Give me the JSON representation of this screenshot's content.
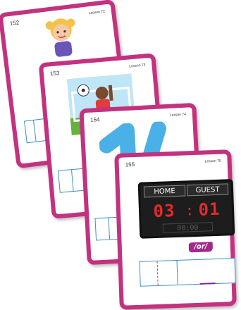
{
  "colors": {
    "card_border": "#c2327f",
    "box_border": "#3a8fc9",
    "scoreboard_digits": "#e32b2b",
    "phoneme_badge": "#a3288c"
  },
  "cards": [
    {
      "number": "152",
      "lesson": "Lesson 72",
      "picture": "girl-illustration"
    },
    {
      "number": "153",
      "lesson": "Lesson 73",
      "picture": "soccer-goalie-illustration"
    },
    {
      "number": "154",
      "lesson": "Lesson 74",
      "picture": "number-14-illustration"
    },
    {
      "number": "155",
      "lesson": "Lesson 75",
      "picture": "scoreboard-illustration"
    }
  ],
  "scoreboard": {
    "home_label": "HOME",
    "guest_label": "GUEST",
    "home_score": "03",
    "guest_score": "01",
    "clock": "00:00"
  },
  "phoneme": "/or/"
}
